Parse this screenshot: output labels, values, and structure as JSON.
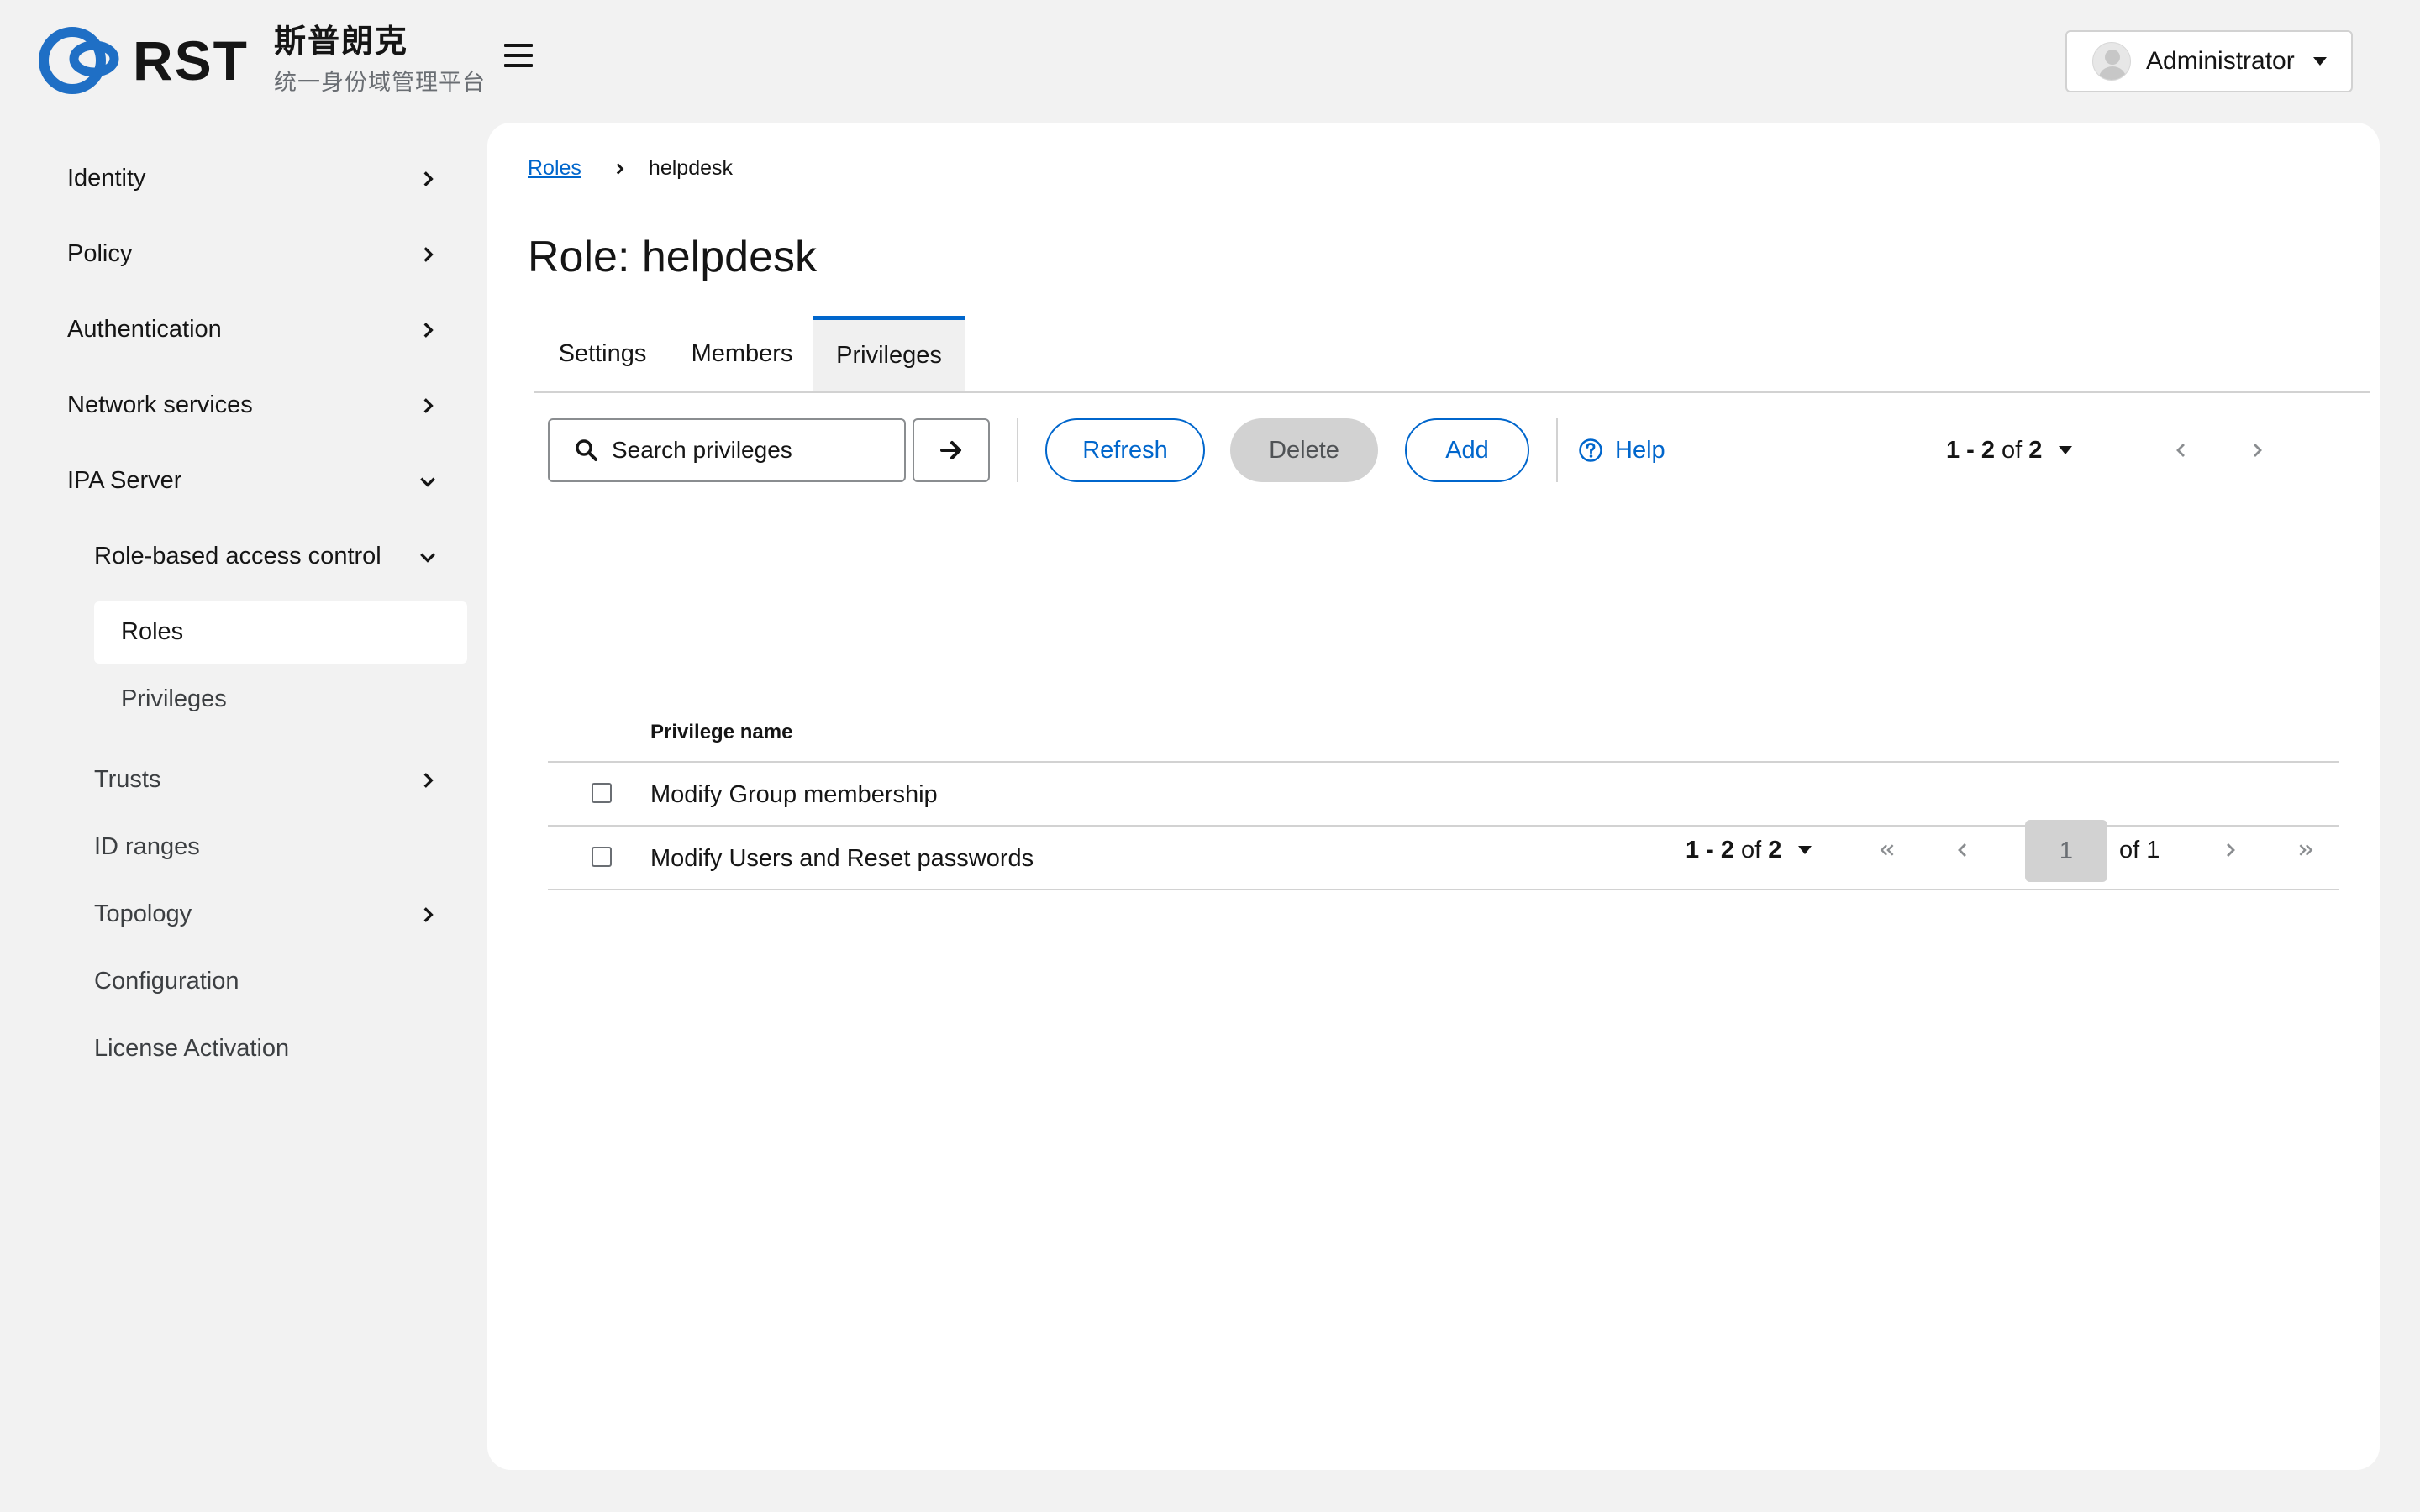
{
  "brand": {
    "logo_word": "RST",
    "name_cn": "斯普朗克",
    "subtitle_cn": "统一身份域管理平台",
    "colors": {
      "primary": "#0066cc",
      "logo_blue": "#1f6fc5"
    }
  },
  "header": {
    "menu_icon": "hamburger-icon",
    "user": {
      "name": "Administrator",
      "avatar_icon": "avatar-icon",
      "dropdown_icon": "caret-down-icon"
    }
  },
  "sidebar": {
    "items": [
      {
        "label": "Identity",
        "expanded": false
      },
      {
        "label": "Policy",
        "expanded": false
      },
      {
        "label": "Authentication",
        "expanded": false
      },
      {
        "label": "Network services",
        "expanded": false
      },
      {
        "label": "IPA Server",
        "expanded": true
      },
      {
        "label": "Role-based access control",
        "expanded": true
      },
      {
        "label": "Roles",
        "active": true
      },
      {
        "label": "Privileges"
      },
      {
        "label": "Trusts",
        "expanded": false
      },
      {
        "label": "ID ranges"
      },
      {
        "label": "Topology",
        "expanded": false
      },
      {
        "label": "Configuration"
      },
      {
        "label": "License Activation"
      }
    ]
  },
  "breadcrumb": {
    "parent": "Roles",
    "current": "helpdesk"
  },
  "page": {
    "title": "Role: helpdesk"
  },
  "tabs": [
    {
      "label": "Settings",
      "active": false
    },
    {
      "label": "Members",
      "active": false
    },
    {
      "label": "Privileges",
      "active": true
    }
  ],
  "toolbar": {
    "search_placeholder": "Search privileges",
    "search_value": "",
    "refresh_label": "Refresh",
    "delete_label": "Delete",
    "add_label": "Add",
    "help_label": "Help",
    "pager": {
      "range": "1 - 2",
      "of_word": "of",
      "total": "2"
    }
  },
  "table": {
    "column": "Privilege name",
    "rows": [
      {
        "name": "Modify Group membership",
        "checked": false
      },
      {
        "name": "Modify Users and Reset passwords",
        "checked": false
      }
    ]
  },
  "pagination": {
    "range": "1 - 2",
    "of_word": "of",
    "total": "2",
    "page": "1",
    "page_of": "of 1"
  }
}
